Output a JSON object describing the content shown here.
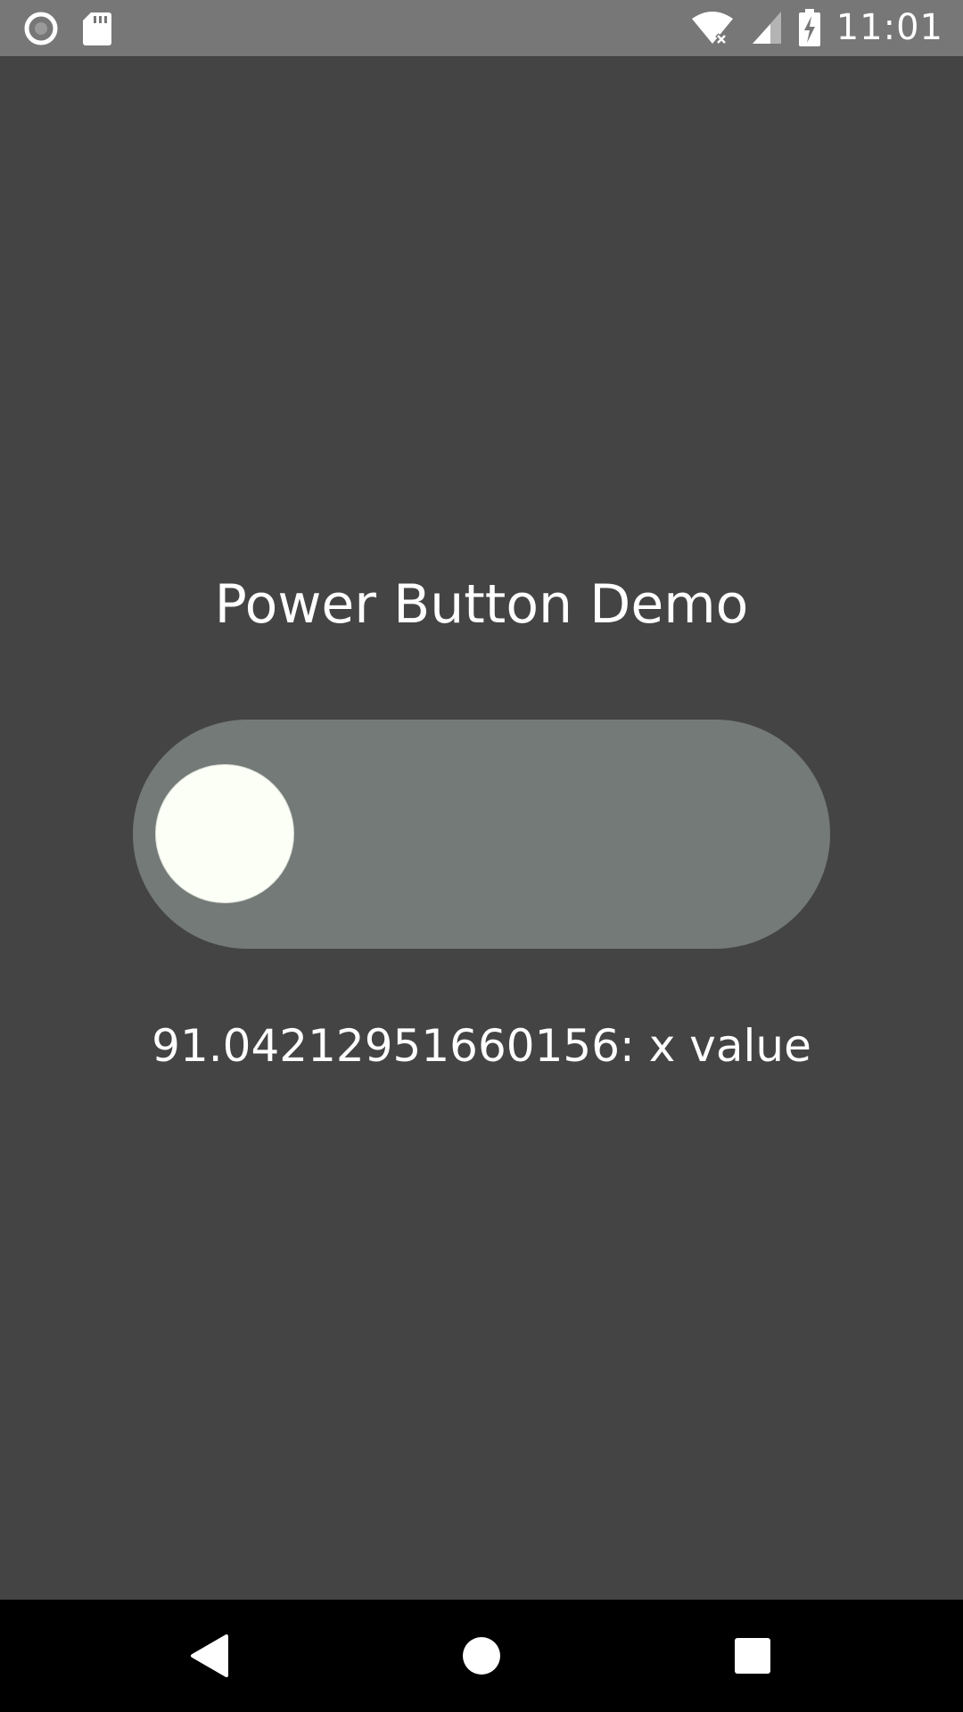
{
  "status_bar": {
    "time": "11:01",
    "icons": [
      "record-icon",
      "sd-card-icon",
      "wifi-no-internet-icon",
      "cell-signal-icon",
      "battery-charging-icon"
    ]
  },
  "main": {
    "title": "Power Button Demo",
    "toggle": {
      "state": "off"
    },
    "x_value_text": "91.04212951660156: x value"
  },
  "nav_bar": {
    "buttons": [
      "back-icon",
      "home-icon",
      "recents-icon"
    ]
  },
  "colors": {
    "background": "#444444",
    "status_bar": "#777777",
    "toggle_track": "#747a78",
    "toggle_knob": "#fbfff6",
    "nav_bar": "#000000"
  }
}
